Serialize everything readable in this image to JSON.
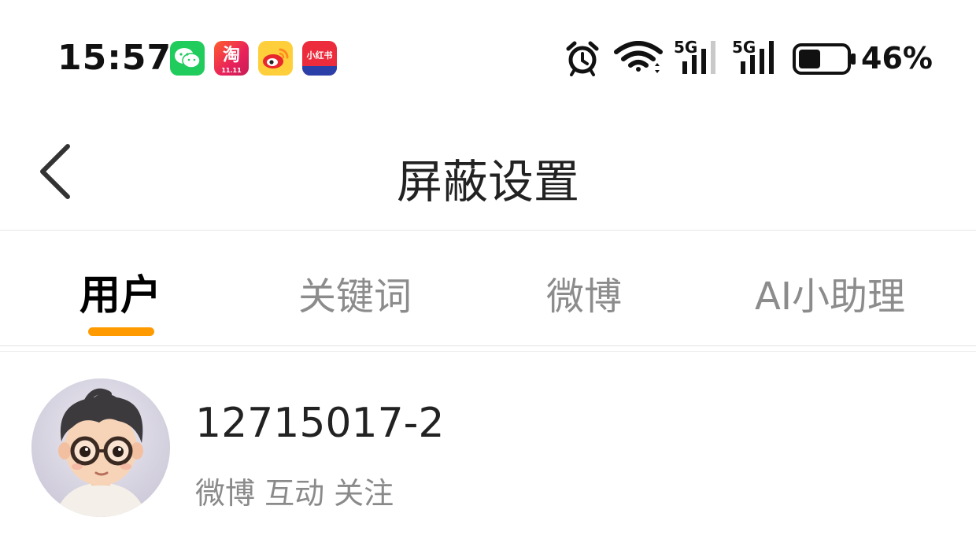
{
  "status_bar": {
    "time": "15:57",
    "notification_icons": [
      "wechat-icon",
      "taobao-icon",
      "weibo-icon",
      "xiaohongshu-icon"
    ],
    "taobao_glyph": "淘",
    "taobao_sub": "11.11",
    "xiaohongshu_glyph": "小红书",
    "system_icons": [
      "alarm-icon",
      "wifi-icon",
      "signal-5g-icon",
      "signal-5g-icon",
      "battery-icon"
    ],
    "signal_label_1": "5G",
    "signal_label_2": "5G",
    "battery_level": 0.46,
    "battery_text": "46%"
  },
  "nav": {
    "title": "屏蔽设置",
    "back_icon": "chevron-left-icon"
  },
  "tabs": {
    "items": [
      {
        "label": "用户",
        "active": true
      },
      {
        "label": "关键词",
        "active": false
      },
      {
        "label": "微博",
        "active": false
      },
      {
        "label": "AI小助理",
        "active": false
      }
    ],
    "accent_color": "#ff9b00"
  },
  "blocked_users": [
    {
      "name": "12715017-2",
      "scope": "微博 互动 关注"
    }
  ]
}
